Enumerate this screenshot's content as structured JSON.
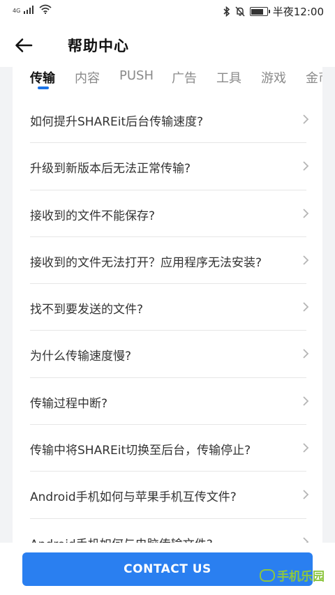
{
  "status_bar": {
    "network": "4G",
    "time": "半夜12:00"
  },
  "header": {
    "title": "帮助中心"
  },
  "tabs": [
    {
      "label": "传输",
      "active": true
    },
    {
      "label": "内容",
      "active": false
    },
    {
      "label": "PUSH",
      "active": false
    },
    {
      "label": "广告",
      "active": false
    },
    {
      "label": "工具",
      "active": false
    },
    {
      "label": "游戏",
      "active": false
    },
    {
      "label": "金币",
      "active": false
    }
  ],
  "faq_items": [
    "如何提升SHAREit后台传输速度?",
    "升级到新版本后无法正常传输?",
    "接收到的文件不能保存?",
    "接收到的文件无法打开？应用程序无法安装?",
    "找不到要发送的文件?",
    "为什么传输速度慢?",
    "传输过程中断?",
    "传输中将SHAREit切换至后台，传输停止?",
    "Android手机如何与苹果手机互传文件?",
    "Android手机如何与电脑传输文件?"
  ],
  "contact_button": "CONTACT US",
  "watermark": "手机乐园",
  "colors": {
    "accent": "#2a7ff0",
    "tab_indicator": "#1a73e8",
    "page_bg": "#f2f3f5"
  },
  "icons": {
    "back": "arrow-left-icon",
    "chevron": "chevron-right-icon",
    "bluetooth": "bluetooth-icon",
    "mute": "bell-off-icon",
    "battery": "battery-icon",
    "wifi": "wifi-icon",
    "signal": "signal-icon"
  }
}
